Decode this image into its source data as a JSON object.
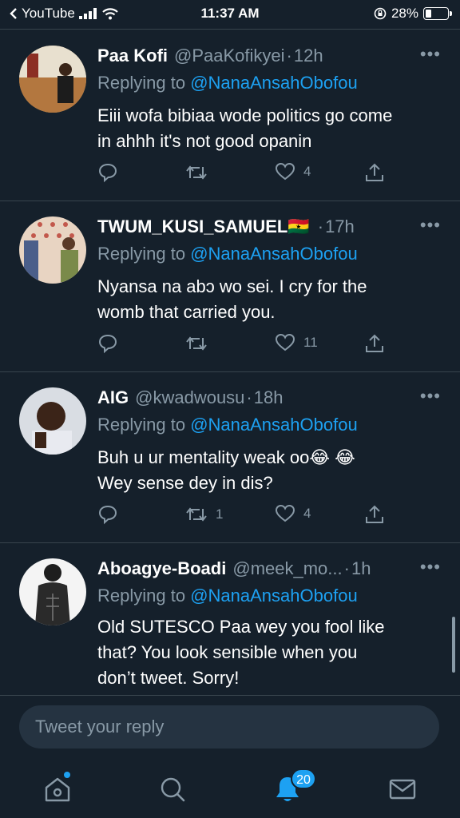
{
  "status_bar": {
    "back_app": "YouTube",
    "time": "11:37 AM",
    "battery": "28%",
    "battery_level": 0.28
  },
  "tweets": [
    {
      "name": "Paa Kofi",
      "handle": "@PaaKofikyei",
      "time": "12h",
      "replying_prefix": "Replying to",
      "replying_to": "@NanaAnsahObofou",
      "lines": [
        "Eiii wofa bibiaa wode politics go come",
        "in ahhh it's not good opanin"
      ],
      "retweets": "",
      "likes": "4"
    },
    {
      "name": "TWUM_KUSI_SAMUEL🇬🇭",
      "handle": "",
      "time": "17h",
      "replying_prefix": "Replying to",
      "replying_to": "@NanaAnsahObofou",
      "lines": [
        "Nyansa na abɔ wo sei. I cry for the",
        "womb that carried you."
      ],
      "retweets": "",
      "likes": "11"
    },
    {
      "name": "AIG",
      "handle": "@kwadwousu",
      "time": "18h",
      "replying_prefix": "Replying to",
      "replying_to": "@NanaAnsahObofou",
      "lines": [
        "Buh u ur mentality weak oo😂 😂",
        "Wey sense dey in dis?"
      ],
      "retweets": "1",
      "likes": "4"
    },
    {
      "name": "Aboagye-Boadi",
      "handle": "@meek_mo...",
      "time": "1h",
      "replying_prefix": "Replying to",
      "replying_to": "@NanaAnsahObofou",
      "lines": [
        "Old SUTESCO Paa wey you fool like",
        "that? You look sensible when you",
        "don’t tweet. Sorry!"
      ],
      "retweets": "",
      "likes": ""
    }
  ],
  "reply_bar": {
    "placeholder": "Tweet your reply"
  },
  "nav": {
    "items": [
      "home-icon",
      "search-icon",
      "notifications-icon",
      "messages-icon"
    ],
    "notification_count": "20"
  },
  "colors": {
    "background": "#15202b",
    "accent": "#1da1f2",
    "muted": "#8899a6",
    "divider": "#38444d"
  }
}
